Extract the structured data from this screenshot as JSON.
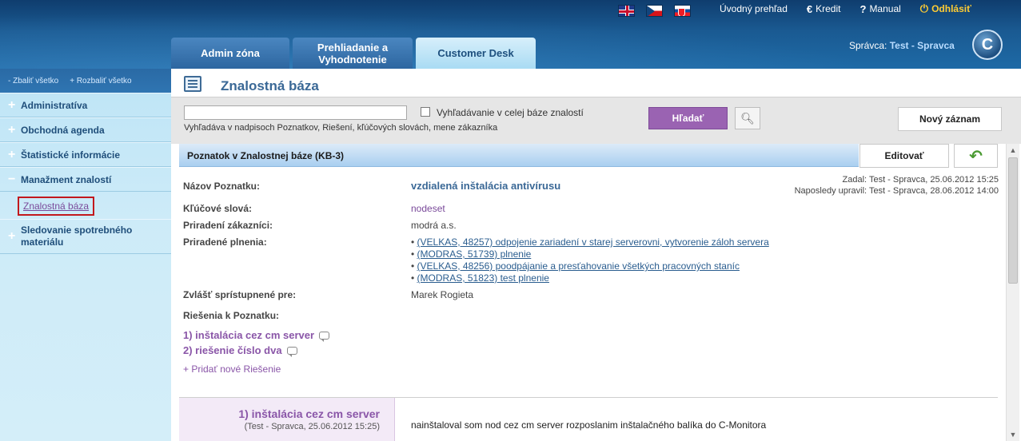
{
  "header": {
    "flags": [
      "uk-flag",
      "cz-flag",
      "sk-flag"
    ],
    "links": {
      "overview": "Úvodný prehľad",
      "credit": "Kredit",
      "manual": "Manual",
      "logout": "Odhlásiť"
    },
    "tabs": [
      "Admin zóna",
      "Prehliadanie a Vyhodnotenie",
      "Customer Desk"
    ],
    "active_tab": "Customer Desk",
    "manager_label": "Správca:",
    "manager_name": "Test - Spravca",
    "logo_letter": "C"
  },
  "sidebar": {
    "collapse_all": "- Zbaliť všetko",
    "expand_all": "+ Rozbaliť všetko",
    "items": [
      {
        "label": "Administratíva"
      },
      {
        "label": "Obchodná agenda"
      },
      {
        "label": "Štatistické informácie"
      },
      {
        "label": "Manažment znalostí"
      },
      {
        "label": "Sledovanie spotrebného materiálu"
      }
    ],
    "active_subitem": "Znalostná báza"
  },
  "page": {
    "title": "Znalostná báza",
    "search": {
      "placeholder": "",
      "checkbox_label": "Vyhľadávanie v celej báze znalostí",
      "hint": "Vyhľadáva v nadpisoch Poznatkov, Riešení, kľúčových slovách, mene zákazníka",
      "search_button": "Hľadať",
      "new_record_button": "Nový záznam"
    },
    "panel": {
      "title": "Poznatok v Znalostnej báze (KB-3)",
      "edit_button": "Editovať",
      "fields": {
        "name_label": "Názov Poznatku:",
        "name_value": "vzdialená inštalácia antivírusu",
        "keywords_label": "Kľúčové slová:",
        "keywords_value": "nodeset",
        "customers_label": "Priradení zákazníci:",
        "customers_value": "modrá a.s.",
        "tasks_label": "Priradené plnenia:",
        "tasks": [
          "(VELKAS, 48257) odpojenie zariadení v starej serverovni, vytvorenie záloh servera",
          "(MODRAS, 51739) plnenie",
          "(VELKAS, 48256) poodpájanie a presťahovanie všetkých pracovných staníc",
          "(MODRAS, 51823) test plnenie"
        ],
        "access_label": "Zvlášť sprístupnené pre:",
        "access_value": "Marek Rogieta",
        "solutions_label": "Riešenia k Poznatku:"
      },
      "meta": {
        "created": "Zadal: Test - Spravca, 25.06.2012 15:25",
        "modified": "Naposledy upravil: Test - Spravca, 28.06.2012 14:00"
      },
      "solutions": [
        "1) inštalácia cez cm server",
        "2) riešenie číslo dva"
      ],
      "add_solution": "+ Pridať nové Riešenie",
      "solution_detail": {
        "title": "1) inštalácia cez cm server",
        "meta": "(Test - Spravca, 25.06.2012 15:25)",
        "text": "nainštaloval som nod cez cm server rozposlanim inštalačného balíka do C-Monitora"
      }
    }
  },
  "colors": {
    "header_bg": "#1a5a92",
    "accent_purple": "#9a63b2",
    "link_blue": "#2a5d8f",
    "logout_yellow": "#ffcc33"
  }
}
